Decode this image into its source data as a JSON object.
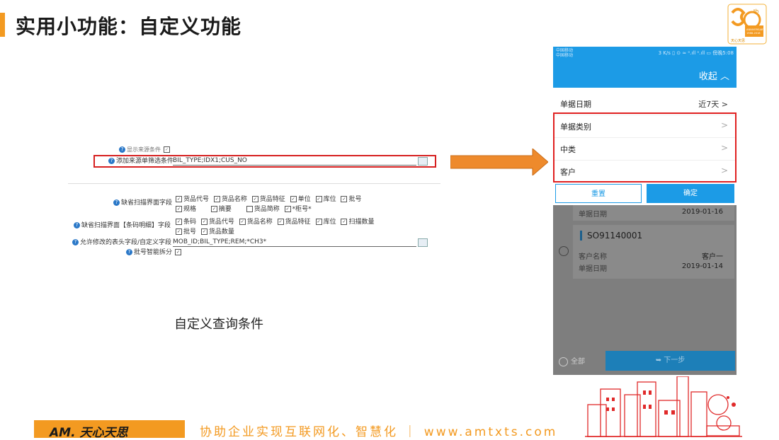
{
  "slide": {
    "title": "实用小功能：自定义功能",
    "caption": "自定义查询条件"
  },
  "badge": {
    "lines": [
      "th",
      "ANNIVERSARY",
      "1988-2018",
      "天心天思"
    ]
  },
  "config": {
    "row0_text": "显示来源条件",
    "filter_label": "添加来源单筛选条件",
    "filter_value": "BIL_TYPE;IDX1;CUS_NO",
    "scan_default_label": "缺省扫描界面字段",
    "scan_row1": [
      "货品代号",
      "货品名称",
      "货品特征",
      "单位",
      "库位",
      "批号"
    ],
    "scan_row2": [
      "规格",
      "摘要",
      "货品简称",
      "*柜号*"
    ],
    "scan_row2_checked": [
      true,
      true,
      false,
      true
    ],
    "barcode_label": "缺省扫描界面【条码明细】字段",
    "barcode_row1": [
      "条码",
      "货品代号",
      "货品名称",
      "货品特征",
      "库位",
      "扫描数量"
    ],
    "barcode_row2": [
      "批号",
      "货品数量"
    ],
    "editable_label": "允许修改的表头字段/自定义字段",
    "editable_value": "MOB_ID;BIL_TYPE;REM;*CH3*",
    "batch_split_label": "批号智能拆分"
  },
  "phone": {
    "status_left_line1": "中国移动",
    "status_left_line2": "中国移动",
    "status_right": "3 K/s ▯ ⊙ ≈ ᵃ.ıll ᵃ.ıll ▭ 傍晚5:08",
    "collapse_label": "收起 ︿",
    "filters": [
      {
        "label": "单据日期",
        "value": "近7天 >"
      },
      {
        "label": "单据类别",
        "value": ">"
      },
      {
        "label": "中类",
        "value": ">"
      },
      {
        "label": "客户",
        "value": ">"
      }
    ],
    "reset_label": "重置",
    "confirm_label": "确定",
    "card0": {
      "date_label": "单据日期",
      "date_value": "2019-01-16"
    },
    "card1": {
      "order_no": "SO91140001",
      "customer_label": "客户名称",
      "customer_value": "客户一",
      "date_label": "单据日期",
      "date_value": "2019-01-14"
    },
    "select_all_label": "全部",
    "next_label": "下一步"
  },
  "footer": {
    "logo_text": "AM. 天心天思",
    "slogan": "协助企业实现互联网化、智慧化 ｜ www.amtxts.com"
  },
  "colors": {
    "accent": "#f39a21",
    "phone_blue": "#1c9be6",
    "highlight_red": "#d62020"
  }
}
